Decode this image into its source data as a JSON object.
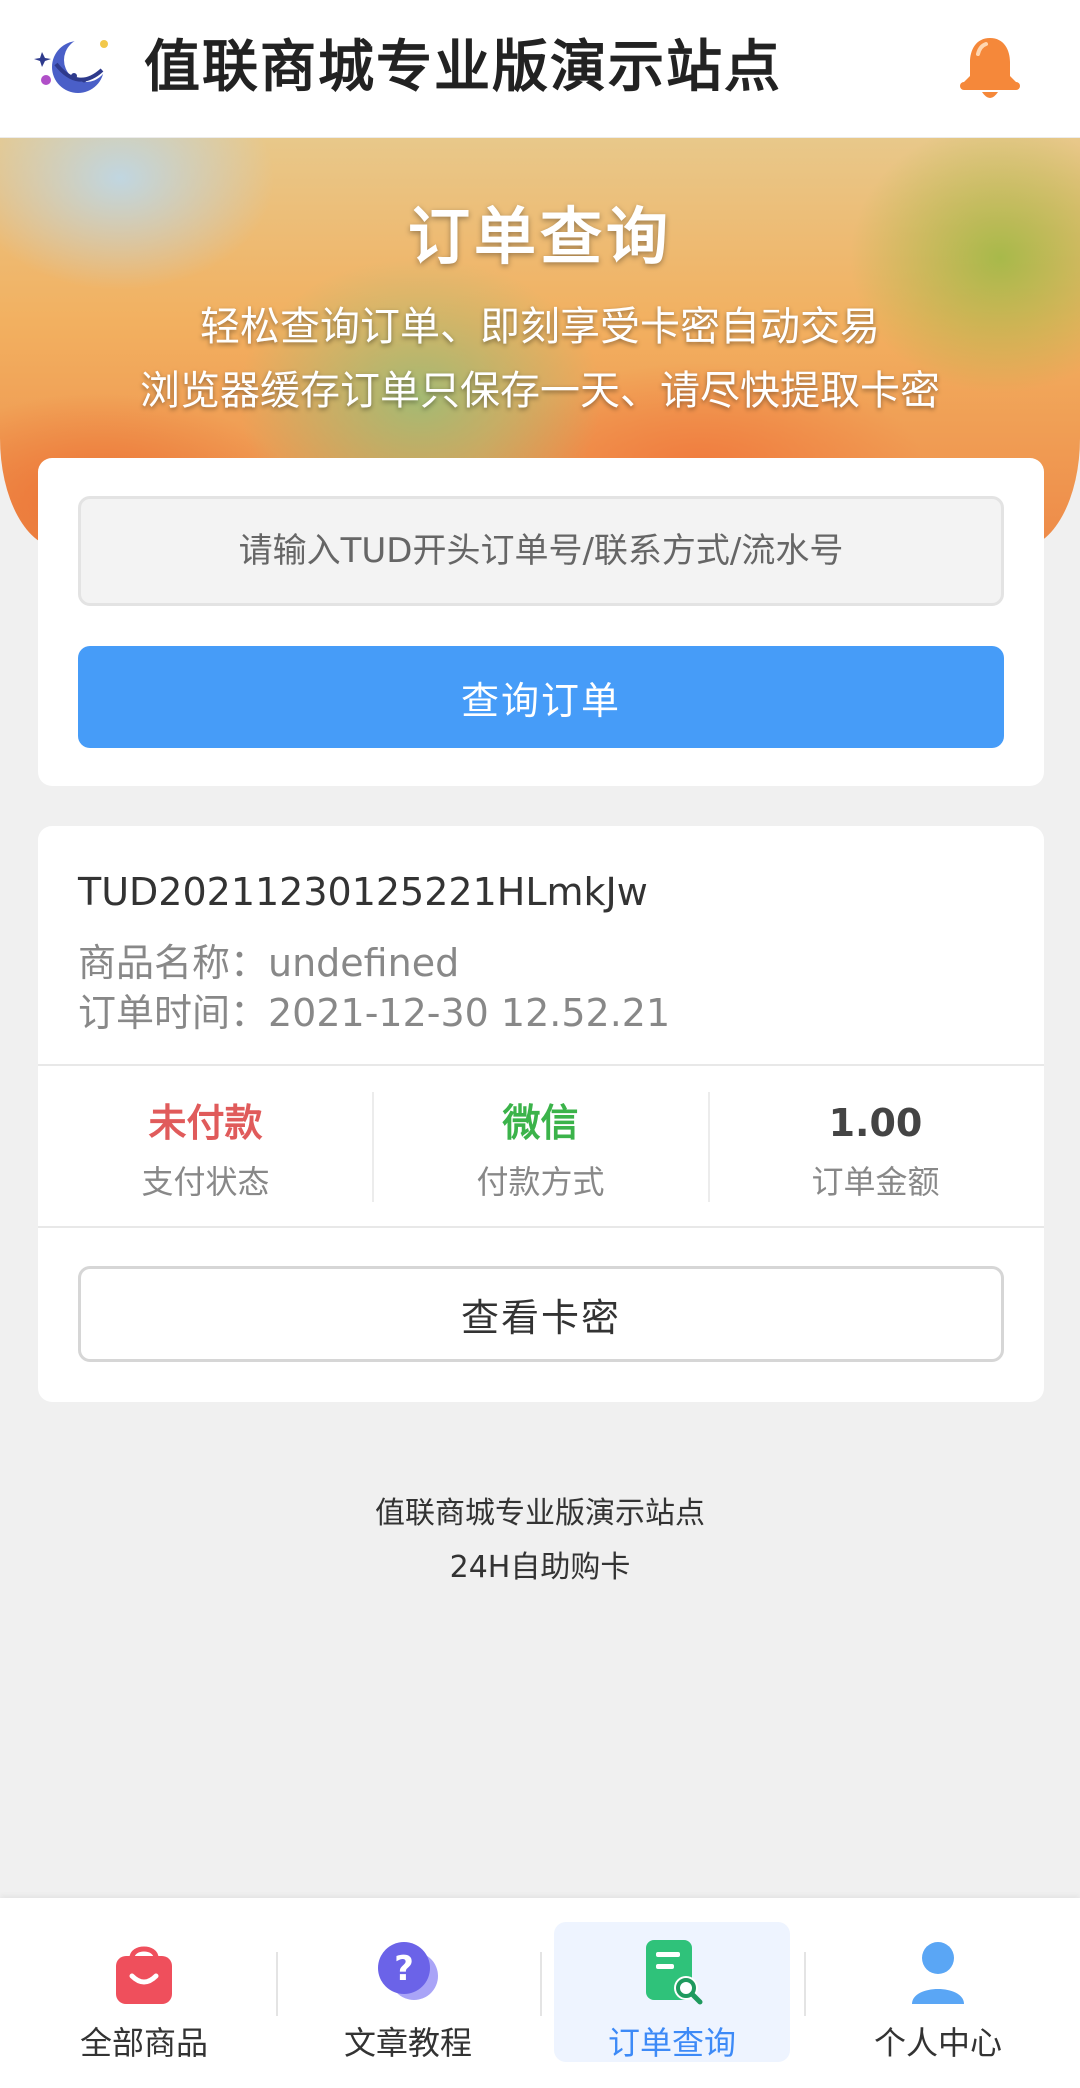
{
  "header": {
    "site_title": "值联商城专业版演示站点",
    "logo_icon": "moon-planet-logo-icon",
    "bell_icon": "bell-icon",
    "bell_color": "#f5883a"
  },
  "banner": {
    "title": "订单查询",
    "subtitle_line1": "轻松查询订单、即刻享受卡密自动交易",
    "subtitle_line2": "浏览器缓存订单只保存一天、请尽快提取卡密"
  },
  "search": {
    "placeholder": "请输入TUD开头订单号/联系方式/流水号",
    "value": "",
    "button_label": "查询订单",
    "button_color": "#469cf8"
  },
  "order": {
    "order_id": "TUD20211230125221HLmkJw",
    "product_line": "商品名称：undefined",
    "time_line": "订单时间：2021-12-30 12.52.21",
    "stats": [
      {
        "value": "未付款",
        "label": "支付状态",
        "color": "#e05b5b"
      },
      {
        "value": "微信",
        "label": "付款方式",
        "color": "#3bb34a"
      },
      {
        "value": "1.00",
        "label": "订单金额",
        "color": "#444444"
      }
    ],
    "view_button_label": "查看卡密"
  },
  "footer": {
    "line1": "值联商城专业版演示站点",
    "line2": "24H自助购卡"
  },
  "bottom_nav": {
    "items": [
      {
        "label": "全部商品",
        "icon": "shopping-bag-icon",
        "active": false
      },
      {
        "label": "文章教程",
        "icon": "question-chat-icon",
        "active": false
      },
      {
        "label": "订单查询",
        "icon": "order-search-icon",
        "active": true
      },
      {
        "label": "个人中心",
        "icon": "user-profile-icon",
        "active": false
      }
    ],
    "active_color": "#3d8af7"
  }
}
